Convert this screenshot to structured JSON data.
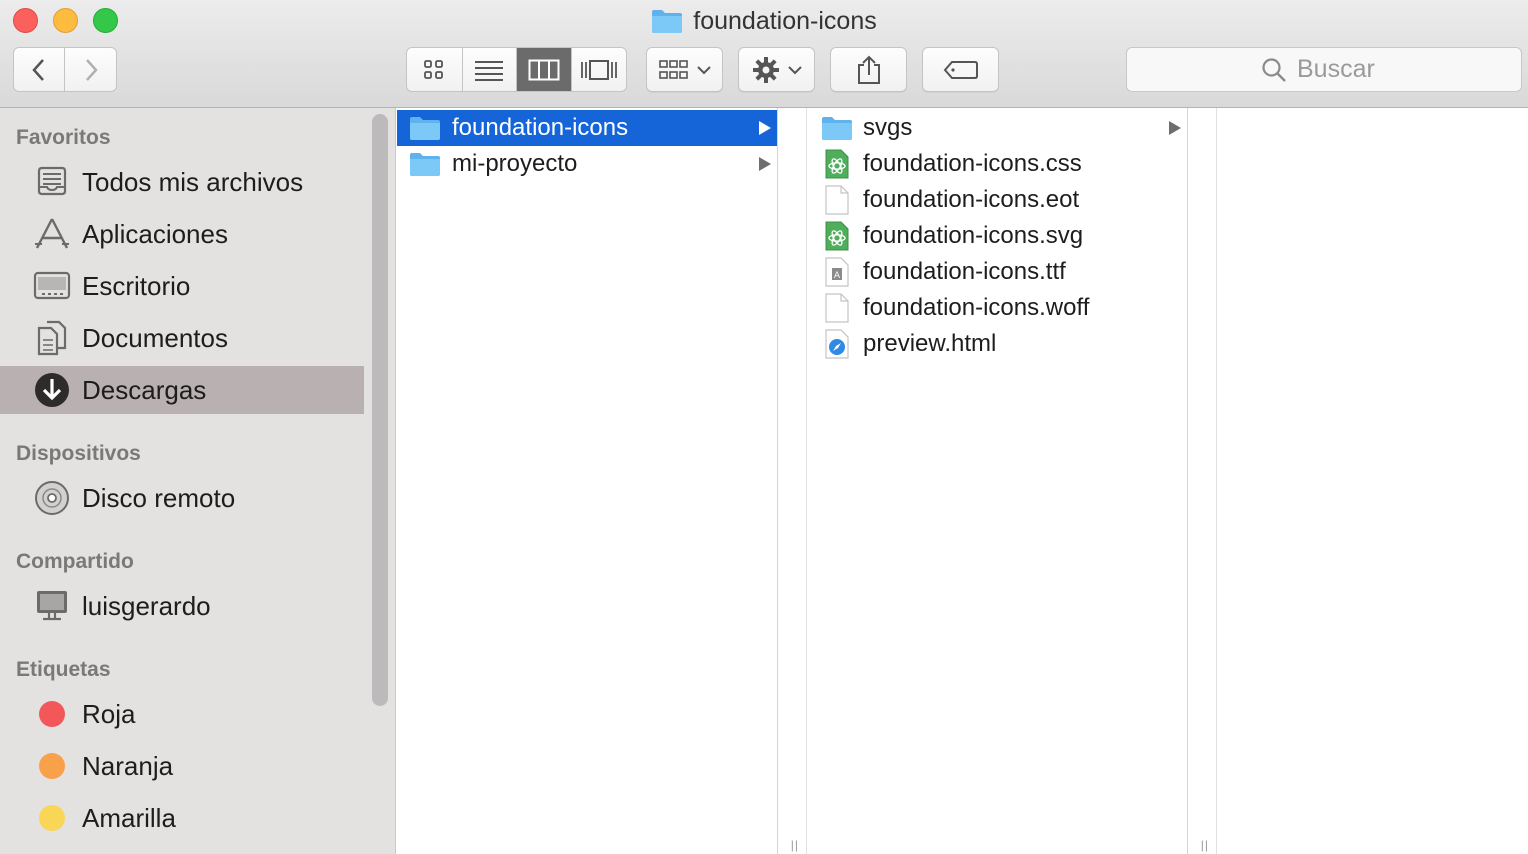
{
  "window": {
    "title": "foundation-icons"
  },
  "toolbar": {
    "search_placeholder": "Buscar",
    "view_modes": [
      "icon-view",
      "list-view",
      "column-view",
      "cover-flow-view"
    ],
    "active_view": "column-view"
  },
  "sidebar": {
    "sections": {
      "favoritos": "Favoritos",
      "dispositivos": "Dispositivos",
      "compartido": "Compartido",
      "etiquetas": "Etiquetas"
    },
    "favorites": [
      {
        "label": "Todos mis archivos",
        "icon": "all-files-icon"
      },
      {
        "label": "Aplicaciones",
        "icon": "applications-icon"
      },
      {
        "label": "Escritorio",
        "icon": "desktop-icon"
      },
      {
        "label": "Documentos",
        "icon": "documents-icon"
      },
      {
        "label": "Descargas",
        "icon": "downloads-icon",
        "selected": true
      }
    ],
    "devices": [
      {
        "label": "Disco remoto",
        "icon": "disc-icon"
      }
    ],
    "shared": [
      {
        "label": "luisgerardo",
        "icon": "computer-icon"
      }
    ],
    "tags": [
      {
        "label": "Roja",
        "color": "#f2585a"
      },
      {
        "label": "Naranja",
        "color": "#f8a14a"
      },
      {
        "label": "Amarilla",
        "color": "#f9d656"
      }
    ]
  },
  "columns": {
    "column1": [
      {
        "name": "foundation-icons",
        "type": "folder",
        "selected": true
      },
      {
        "name": "mi-proyecto",
        "type": "folder"
      }
    ],
    "column2": [
      {
        "name": "svgs",
        "type": "folder"
      },
      {
        "name": "foundation-icons.css",
        "type": "css-file"
      },
      {
        "name": "foundation-icons.eot",
        "type": "blank-file"
      },
      {
        "name": "foundation-icons.svg",
        "type": "svg-file"
      },
      {
        "name": "foundation-icons.ttf",
        "type": "font-file"
      },
      {
        "name": "foundation-icons.woff",
        "type": "blank-file"
      },
      {
        "name": "preview.html",
        "type": "html-file"
      }
    ]
  },
  "colors": {
    "selection": "#1565d8",
    "sidebar_selected": "#b8b0b1",
    "folder": "#6cbef2"
  }
}
